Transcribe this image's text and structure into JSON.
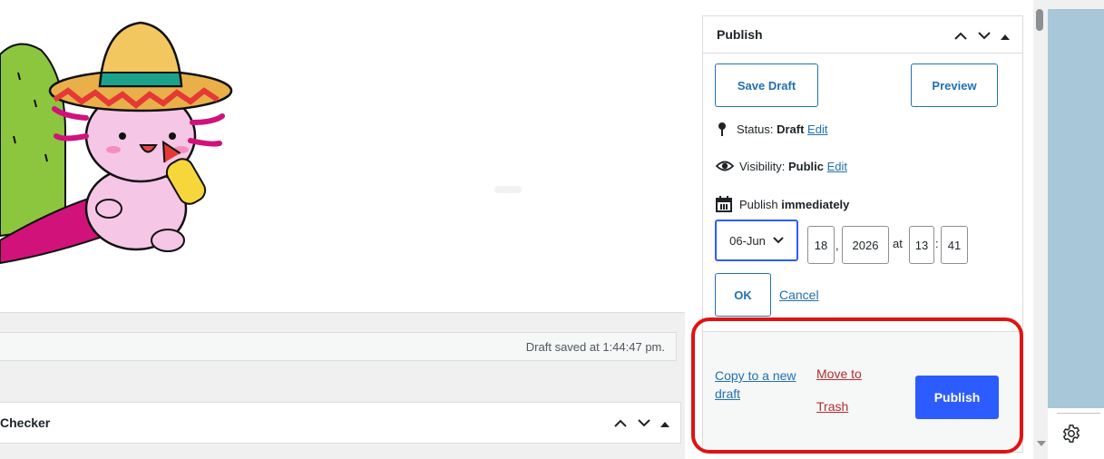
{
  "editor": {
    "draft_saved": "Draft saved at 1:44:47 pm.",
    "checker_title": "Checker"
  },
  "publish": {
    "title": "Publish",
    "save_draft": "Save Draft",
    "preview": "Preview",
    "status_label": "Status: ",
    "status_value": "Draft",
    "status_edit": "Edit",
    "visibility_label": "Visibility: ",
    "visibility_value": "Public",
    "visibility_edit": "Edit",
    "publish_label": "Publish ",
    "publish_value": "immediately",
    "date": {
      "month": "06-Jun",
      "day": "18",
      "year": "2026",
      "at": "at",
      "hour": "13",
      "minute": "41"
    },
    "ok": "OK",
    "cancel": "Cancel",
    "copy_draft_line1": "Copy to a new",
    "copy_draft_line2": "draft",
    "trash_line1": "Move to",
    "trash_line2": "Trash",
    "publish_button": "Publish"
  },
  "icons": [
    "pin-icon",
    "eye-icon",
    "calendar-icon",
    "chevron-down-icon",
    "gear-icon"
  ],
  "colors": {
    "accent": "#2271b1",
    "publish_button": "#2c5cff",
    "trash": "#b32d2e",
    "highlight": "#e01313"
  }
}
